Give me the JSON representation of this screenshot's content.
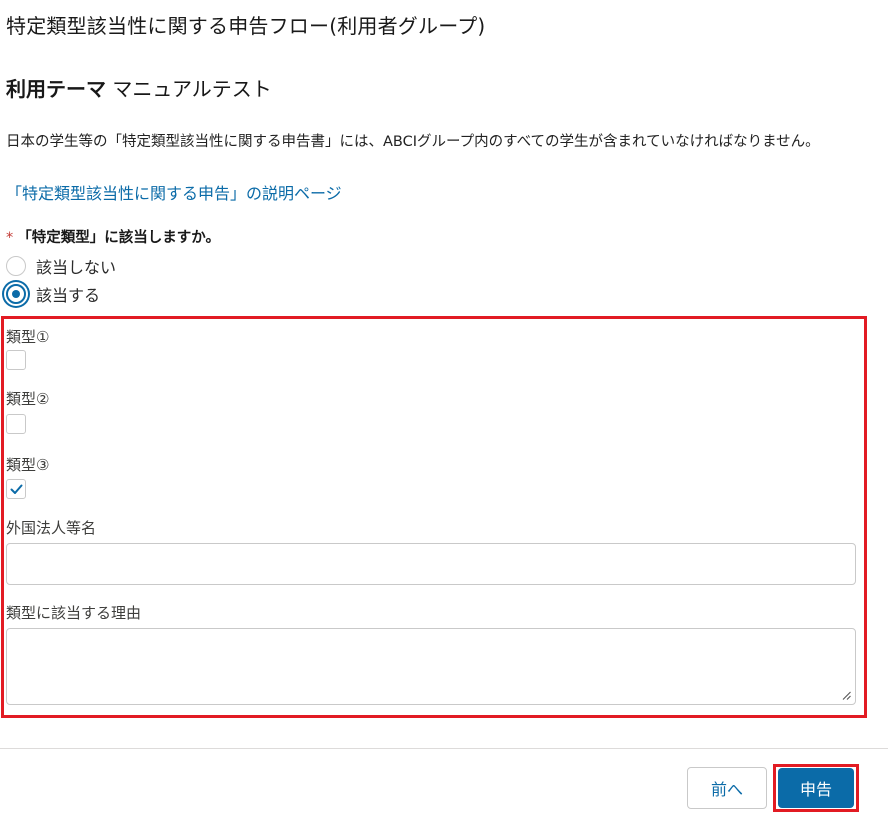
{
  "page": {
    "title": "特定類型該当性に関する申告フロー(利用者グループ)"
  },
  "theme": {
    "label": "利用テーマ",
    "value": "マニュアルテスト"
  },
  "description": "日本の学生等の「特定類型該当性に関する申告書」には、ABCIグループ内のすべての学生が含まれていなければなりません。",
  "help_link": "「特定類型該当性に関する申告」の説明ページ",
  "question": {
    "required_mark": "*",
    "text": "「特定類型」に該当しますか。",
    "options": [
      {
        "label": "該当しない",
        "selected": false
      },
      {
        "label": "該当する",
        "selected": true
      }
    ]
  },
  "fields": {
    "type1": {
      "label": "類型①",
      "checked": false
    },
    "type2": {
      "label": "類型②",
      "checked": false
    },
    "type3": {
      "label": "類型③",
      "checked": true
    },
    "foreign_entity": {
      "label": "外国法人等名",
      "value": ""
    },
    "reason": {
      "label": "類型に該当する理由",
      "value": ""
    }
  },
  "footer": {
    "prev_label": "前へ",
    "submit_label": "申告"
  },
  "colors": {
    "accent": "#0b6ba8",
    "highlight": "#e21b23",
    "required": "#c23934"
  }
}
